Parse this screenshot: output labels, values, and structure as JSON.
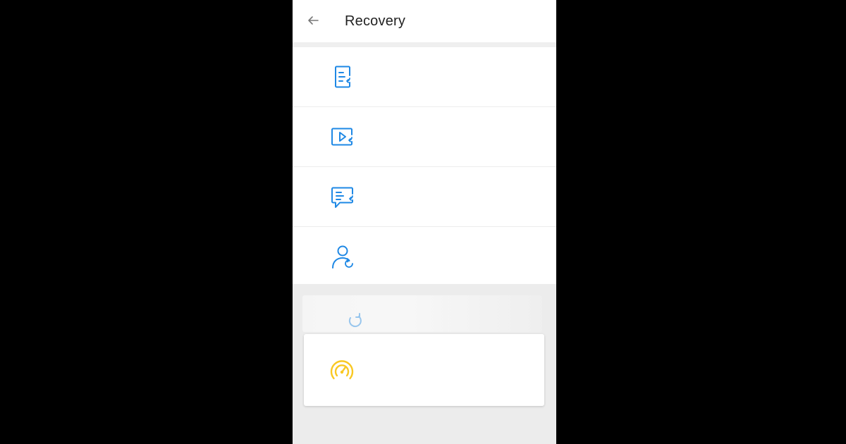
{
  "app_bar": {
    "title": "Recovery",
    "back_icon": "arrow-left-icon"
  },
  "list": {
    "items": [
      {
        "icon": "document-restore-icon",
        "label": "",
        "color": "#1e88e5"
      },
      {
        "icon": "video-restore-icon",
        "label": "",
        "color": "#1e88e5"
      },
      {
        "icon": "message-restore-icon",
        "label": "",
        "color": "#1e88e5"
      },
      {
        "icon": "contact-restore-icon",
        "label": "",
        "color": "#1e88e5"
      }
    ]
  },
  "faded_item": {
    "icon": "restore-icon",
    "color": "#1e88e5"
  },
  "card": {
    "icon": "speedometer-icon",
    "label": "",
    "color": "#f9c823"
  },
  "colors": {
    "background": "#000000",
    "accent_blue": "#1e88e5",
    "accent_yellow": "#f9c823"
  }
}
